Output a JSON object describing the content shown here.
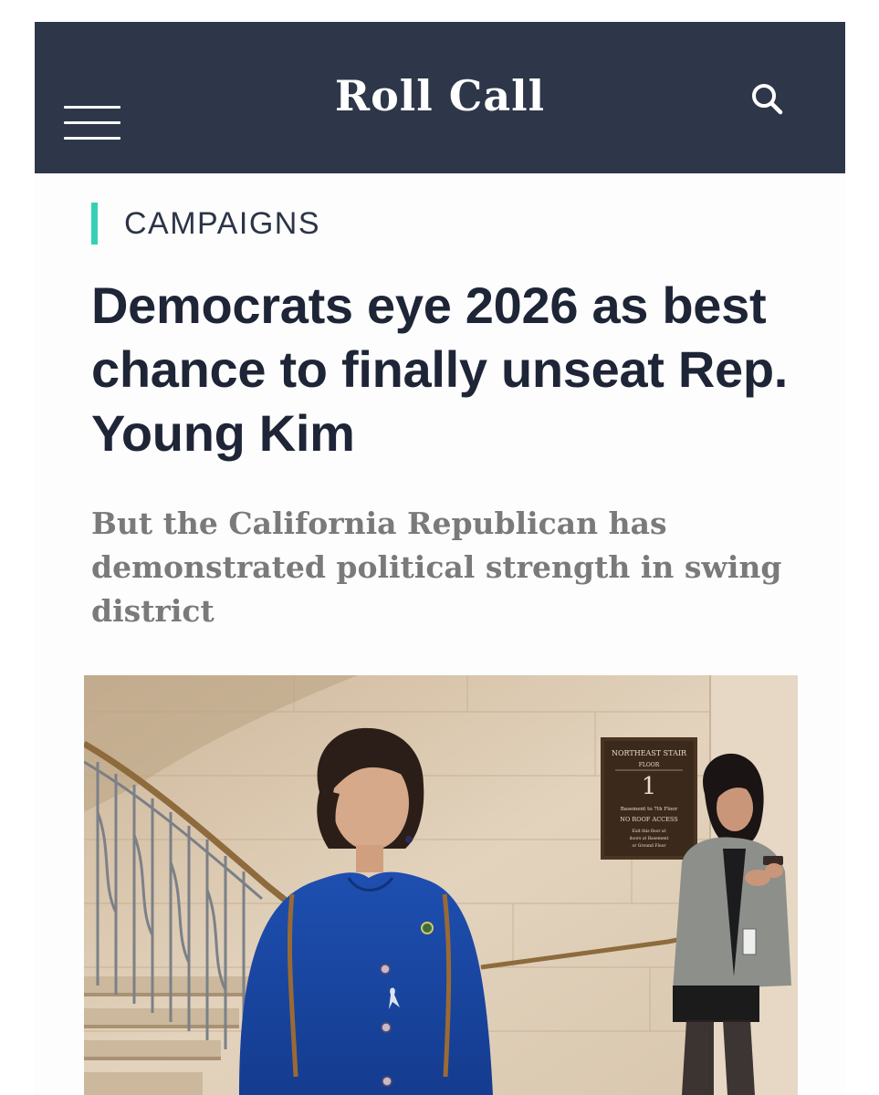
{
  "header": {
    "site_name": "Roll Call",
    "menu_icon": "hamburger-menu-icon",
    "search_icon": "search-icon",
    "background_color": "#2d3749"
  },
  "article": {
    "section": "CAMPAIGNS",
    "section_accent_color": "#35d0b4",
    "headline": "Democrats eye 2026 as best chance to finally unseat Rep. Young Kim",
    "dek": "But the California Republican has demonstrated political strength in swing district"
  },
  "photo": {
    "sign": {
      "line1": "NORTHEAST STAIR",
      "line2": "FLOOR",
      "floor_number": "1",
      "line3": "Basement to 7th Floor",
      "line4": "NO ROOF ACCESS",
      "line5": "Exit this floor at",
      "line6": "doors at Basement",
      "line7": "or Ground Floor"
    }
  }
}
